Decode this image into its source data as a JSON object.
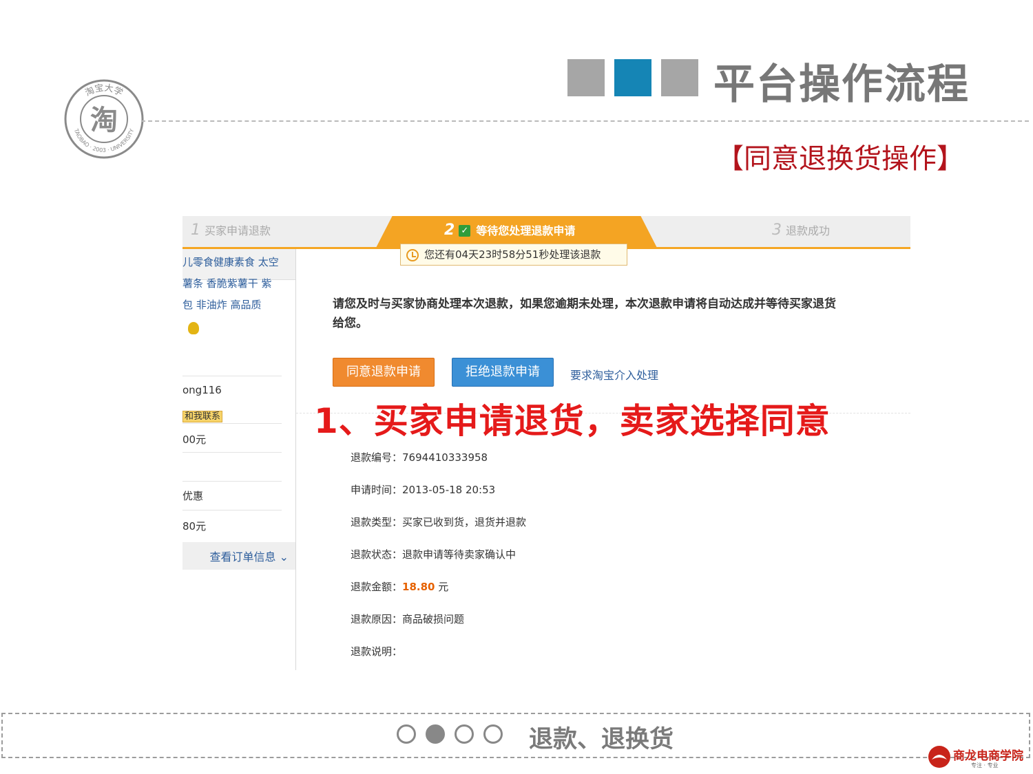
{
  "slide": {
    "title": "平台操作流程",
    "subtitle": "【同意退换货操作】",
    "seal": {
      "center": "淘",
      "top": "淘宝大学",
      "bottom": "TAOBAO · 2003 · UNIVERSITY"
    },
    "square_colors": [
      "#a6a6a6",
      "#1585b5",
      "#a6a6a6"
    ],
    "accent_red": "#b3141c"
  },
  "steps": [
    {
      "num": "1",
      "label": "买家申请退款"
    },
    {
      "num": "2",
      "label": "等待您处理退款申请"
    },
    {
      "num": "3",
      "label": "退款成功"
    }
  ],
  "timer_text": "您还有04天23时58分51秒处理该退款",
  "sidebar": {
    "desc_lines": [
      "儿零食健康素食 太空",
      "薯条 香脆紫薯干 紫",
      "包 非油炸 高品质"
    ],
    "seller": "ong116",
    "contact": "和我联系",
    "price": "00元",
    "discount": "优惠",
    "total": "80元",
    "view_order": "查看订单信息"
  },
  "notice": [
    "请您及时与买家协商处理本次退款，如果您逾期未处理，本次退款申请将自动达成并等待买家退货",
    "给您。"
  ],
  "actions": {
    "agree": "同意退款申请",
    "refuse": "拒绝退款申请",
    "escalate": "要求淘宝介入处理"
  },
  "callout": "1、买家申请退货，卖家选择同意",
  "details": [
    {
      "label": "退款编号：",
      "value": "7694410333958"
    },
    {
      "label": "申请时间：",
      "value": "2013-05-18 20:53"
    },
    {
      "label": "退款类型：",
      "value": "买家已收到货，退货并退款"
    },
    {
      "label": "退款状态：",
      "value": "退款申请等待卖家确认中"
    },
    {
      "label": "退款金额：",
      "value": "18.80",
      "suffix": " 元"
    },
    {
      "label": "退款原因：",
      "value": "商品破损问题"
    },
    {
      "label": "退款说明：",
      "value": ""
    }
  ],
  "footer": {
    "section_label": "退款、退换货",
    "progress": {
      "current": 2,
      "total": 4
    },
    "brand": "商龙电商学院",
    "brand_tagline": "专注 · 专业"
  }
}
